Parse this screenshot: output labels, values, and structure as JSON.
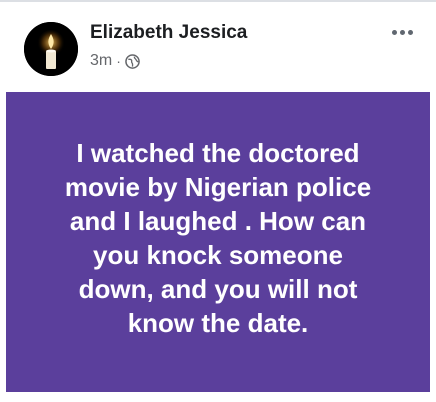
{
  "post": {
    "author_name": "Elizabeth Jessica",
    "timestamp": "3m",
    "separator": "·",
    "privacy_icon": "globe-icon",
    "more_icon": "more-options-icon",
    "text_lines": [
      "I watched the doctored",
      "movie by Nigerian police",
      "and I laughed . How can",
      "you knock someone",
      "down, and you will not",
      "know the date."
    ]
  },
  "colors": {
    "post_background": "#5b3f9c",
    "post_text": "#ffffff",
    "author_text": "#1c1e21",
    "meta_text": "#65676b"
  }
}
